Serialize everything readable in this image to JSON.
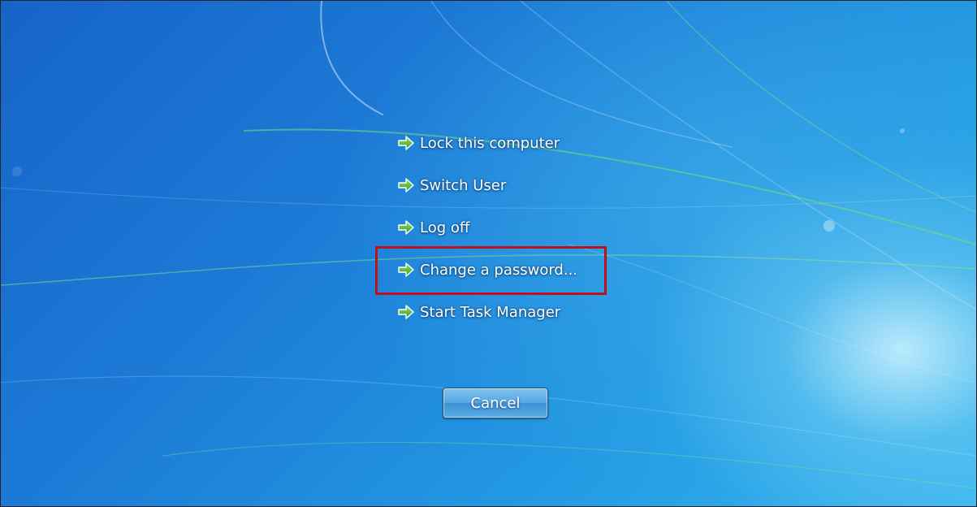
{
  "security_options": {
    "items": [
      {
        "label": "Lock this computer",
        "icon": "green-arrow-icon"
      },
      {
        "label": "Switch User",
        "icon": "green-arrow-icon"
      },
      {
        "label": "Log off",
        "icon": "green-arrow-icon"
      },
      {
        "label": "Change a password...",
        "icon": "green-arrow-icon",
        "highlighted": true
      },
      {
        "label": "Start Task Manager",
        "icon": "green-arrow-icon"
      }
    ],
    "cancel_label": "Cancel"
  },
  "colors": {
    "highlight_border": "#c0111a",
    "arrow_green": "#3fae2a",
    "text": "#ffffff"
  }
}
